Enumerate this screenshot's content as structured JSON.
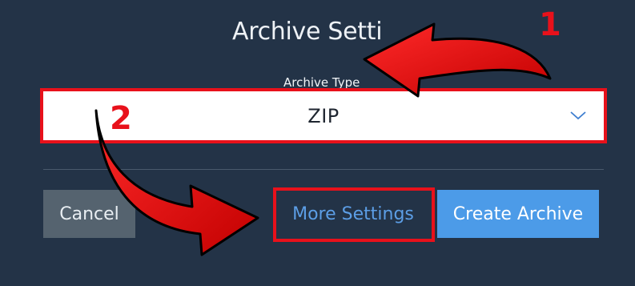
{
  "dialog": {
    "title": "Archive Setti"
  },
  "archive_type": {
    "label": "Archive Type",
    "selected_value": "ZIP"
  },
  "buttons": {
    "cancel": "Cancel",
    "more_settings": "More Settings",
    "create_archive": "Create Archive"
  },
  "annotations": {
    "step_1": "1",
    "step_2": "2",
    "color": "#e8111b"
  },
  "colors": {
    "background": "#233347",
    "primary_button": "#4c9be8",
    "secondary_button": "#55636f",
    "link_text": "#5c9ee6"
  },
  "icons": {
    "dropdown": "chevron-down-icon",
    "arrow_1": "curved-arrow-annotation",
    "arrow_2": "curved-arrow-annotation"
  }
}
